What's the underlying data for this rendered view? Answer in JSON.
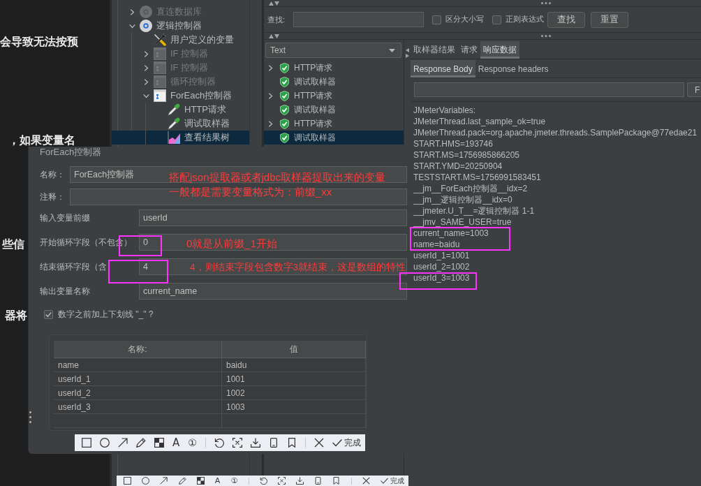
{
  "article": {
    "lines": [
      "会导致无法按预",
      "，如果变量名",
      "些信",
      "器将"
    ]
  },
  "tree": {
    "items": [
      {
        "label": "直连数据库",
        "kind": "gear",
        "disabled": true,
        "expanded": false,
        "selected": false
      },
      {
        "label": "逻辑控制器",
        "kind": "gear",
        "disabled": false,
        "expanded": true,
        "selected": false,
        "children": [
          {
            "label": "用户定义的变量",
            "kind": "config",
            "disabled": false,
            "selected": false
          },
          {
            "label": "IF 控制器",
            "kind": "controller",
            "disabled": true,
            "expanded": false,
            "selected": false
          },
          {
            "label": "IF 控制器",
            "kind": "controller",
            "disabled": true,
            "expanded": false,
            "selected": false
          },
          {
            "label": "循环控制器",
            "kind": "controller",
            "disabled": true,
            "expanded": false,
            "selected": false
          },
          {
            "label": "ForEach控制器",
            "kind": "controller",
            "disabled": false,
            "expanded": true,
            "selected": false,
            "children": [
              {
                "label": "HTTP请求",
                "kind": "sampler",
                "disabled": false,
                "selected": false
              },
              {
                "label": "调试取样器",
                "kind": "sampler",
                "disabled": false,
                "selected": false
              },
              {
                "label": "查看结果树",
                "kind": "listener",
                "disabled": false,
                "selected": true
              }
            ]
          }
        ]
      }
    ]
  },
  "results": {
    "search": {
      "label": "查找:",
      "options": [
        {
          "label": "区分大小写",
          "checked": false
        },
        {
          "label": "正则表达式",
          "checked": false
        }
      ],
      "buttons": [
        "查找",
        "重置"
      ]
    },
    "renderer": {
      "value": "Text"
    },
    "samples": [
      {
        "label": "HTTP请求",
        "success": true,
        "expanded": false,
        "selected": false
      },
      {
        "label": "调试取样器",
        "success": true,
        "selected": false
      },
      {
        "label": "HTTP请求",
        "success": true,
        "expanded": false,
        "selected": false
      },
      {
        "label": "调试取样器",
        "success": true,
        "selected": false
      },
      {
        "label": "HTTP请求",
        "success": true,
        "expanded": false,
        "selected": false
      },
      {
        "label": "调试取样器",
        "success": true,
        "selected": true
      }
    ],
    "tabs": [
      {
        "label": "取样器结果",
        "selected": false
      },
      {
        "label": "请求",
        "selected": false
      },
      {
        "label": "响应数据",
        "selected": true
      }
    ],
    "subtabs": [
      {
        "label": "Response Body",
        "selected": true
      },
      {
        "label": "Response headers",
        "selected": false
      }
    ],
    "find_button": "F",
    "body_lines": [
      "JMeterVariables:",
      "JMeterThread.last_sample_ok=true",
      "JMeterThread.pack=org.apache.jmeter.threads.SamplePackage@77edae21",
      "START.HMS=193746",
      "START.MS=1756985866205",
      "START.YMD=20250904",
      "TESTSTART.MS=1756991583451",
      "__jm__ForEach控制器__idx=2",
      "__jm__逻辑控制器__idx=0",
      "__jmeter.U_T__=逻辑控制器 1-1",
      "__jmv_SAME_USER=true",
      "current_name=1003",
      "name=baidu",
      "userId_1=1001",
      "userId_2=1002",
      "userId_3=1003"
    ]
  },
  "controller": {
    "title": "ForEach控制器",
    "header_fields": [
      {
        "label": "名称：",
        "value": "ForEach控制器"
      },
      {
        "label": "注释："
      }
    ],
    "fields": [
      {
        "label": "输入变量前缀",
        "value": "userId"
      },
      {
        "label": "开始循环字段（不包含）",
        "value": "0"
      },
      {
        "label": "结束循环字段（含",
        "value": "4"
      },
      {
        "label": "输出变量名称",
        "value": "current_name"
      }
    ],
    "underscore_option": {
      "label": "数字之前加上下划线 \"_\" ?",
      "checked": true
    }
  },
  "variables_table": {
    "columns": [
      "名称:",
      "值"
    ],
    "rows": [
      [
        "name",
        "baidu"
      ],
      [
        "userId_1",
        "1001"
      ],
      [
        "userId_2",
        "1002"
      ],
      [
        "userId_3",
        "1003"
      ]
    ]
  },
  "annotations": [
    "搭配json提取器或者jdbc取样器提取出来的变量",
    "一般都是需要变量格式为：前缀_xx",
    "0就是从前缀_1开始",
    "4，则结束字段包含数字3就结束，这是数组的特性"
  ],
  "snip_toolbars": [
    {
      "text_tool": "A",
      "number_tool": "①",
      "done": "完成"
    },
    {
      "text_tool": "A",
      "number_tool": "①",
      "done": "完成"
    }
  ]
}
